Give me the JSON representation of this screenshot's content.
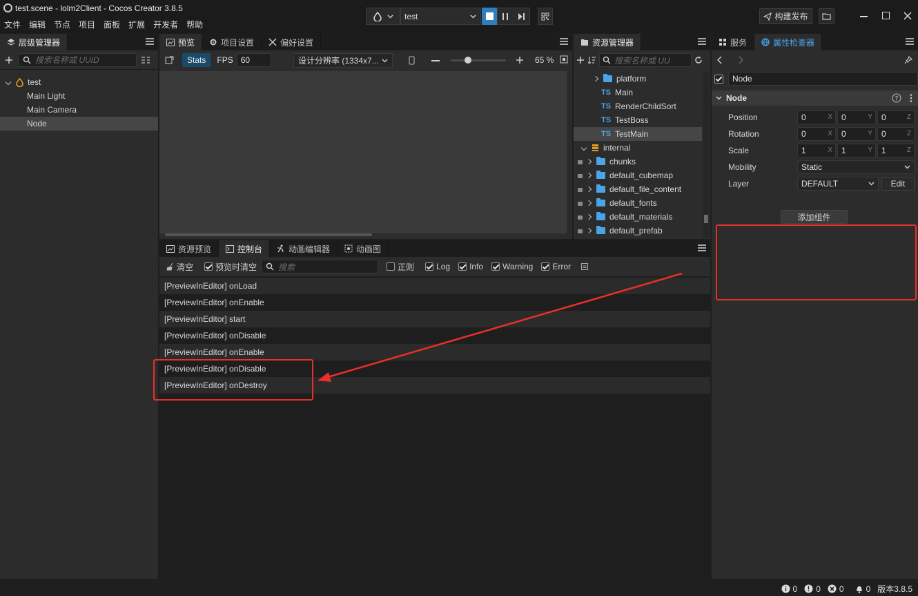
{
  "window": {
    "title": "test.scene - lolm2Client - Cocos Creator 3.8.5"
  },
  "menu": [
    "文件",
    "编辑",
    "节点",
    "项目",
    "面板",
    "扩展",
    "开发者",
    "帮助"
  ],
  "toolbar": {
    "scene_select": "test",
    "build_label": "构建发布"
  },
  "hierarchy": {
    "tab_label": "层级管理器",
    "search_placeholder": "搜索名称或 UUID",
    "nodes": [
      {
        "label": "test"
      },
      {
        "label": "Main Light"
      },
      {
        "label": "Main Camera"
      },
      {
        "label": "Node"
      }
    ]
  },
  "preview": {
    "tabs": [
      "预览",
      "项目设置",
      "偏好设置"
    ],
    "stats_label": "Stats",
    "fps_label": "FPS",
    "fps_value": "60",
    "resolution": "设计分辨率 (1334x7...",
    "zoom": "65 %"
  },
  "assets": {
    "tab_label": "资源管理器",
    "search_placeholder": "搜索名称或 UU",
    "items": [
      {
        "label": "platform",
        "kind": "folder"
      },
      {
        "label": "Main",
        "kind": "ts"
      },
      {
        "label": "RenderChildSort",
        "kind": "ts"
      },
      {
        "label": "TestBoss",
        "kind": "ts"
      },
      {
        "label": "TestMain",
        "kind": "ts"
      },
      {
        "label": "internal",
        "kind": "db"
      },
      {
        "label": "chunks",
        "kind": "folder"
      },
      {
        "label": "default_cubemap",
        "kind": "folder"
      },
      {
        "label": "default_file_content",
        "kind": "folder"
      },
      {
        "label": "default_fonts",
        "kind": "folder"
      },
      {
        "label": "default_materials",
        "kind": "folder"
      },
      {
        "label": "default_prefab",
        "kind": "folder"
      }
    ],
    "ts_badge": "TS"
  },
  "console": {
    "tabs": [
      "资源预览",
      "控制台",
      "动画编辑器",
      "动画图"
    ],
    "clear_label": "清空",
    "clear_on_preview_label": "预览时清空",
    "search_placeholder": "搜索",
    "regex_label": "正则",
    "filters": [
      "Log",
      "Info",
      "Warning",
      "Error"
    ],
    "rows": [
      "[PreviewInEditor] onLoad",
      "[PreviewInEditor] onEnable",
      "[PreviewInEditor] start",
      "[PreviewInEditor] onDisable",
      "[PreviewInEditor] onEnable",
      "[PreviewInEditor] onDisable",
      "[PreviewInEditor] onDestroy"
    ]
  },
  "inspector": {
    "tabs": [
      "服务",
      "属性检查器"
    ],
    "node_name": "Node",
    "section_title": "Node",
    "position": {
      "label": "Position",
      "x": "0",
      "y": "0",
      "z": "0"
    },
    "rotation": {
      "label": "Rotation",
      "x": "0",
      "y": "0",
      "z": "0"
    },
    "scale": {
      "label": "Scale",
      "x": "1",
      "y": "1",
      "z": "1"
    },
    "axis": {
      "x": "X",
      "y": "Y",
      "z": "Z"
    },
    "mobility": {
      "label": "Mobility",
      "value": "Static"
    },
    "layer": {
      "label": "Layer",
      "value": "DEFAULT",
      "edit_label": "Edit"
    },
    "add_component_label": "添加组件"
  },
  "status": {
    "info_count": "0",
    "warn_count": "0",
    "error_count": "0",
    "notice_count": "0",
    "version": "版本3.8.5"
  },
  "colors": {
    "accent": "#4ca4e8",
    "annotation": "#e8302a"
  }
}
